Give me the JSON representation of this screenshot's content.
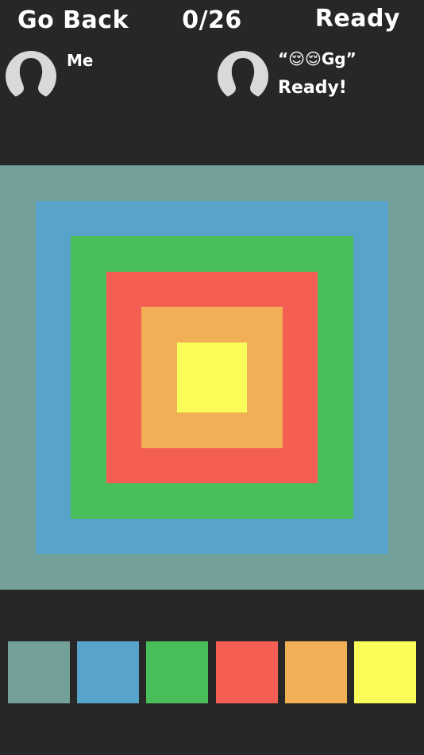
{
  "header": {
    "back_label": "Go Back",
    "score_label": "0/26",
    "ready_label": "Ready"
  },
  "players": {
    "me": {
      "name": "Me",
      "status": ""
    },
    "opponent": {
      "name": "“😌😌Gg”",
      "status": "Ready!"
    }
  },
  "icons": {
    "avatar": "person-silhouette-icon"
  },
  "board": {
    "rings": [
      {
        "color_name": "teal",
        "color": "#73a19a"
      },
      {
        "color_name": "blue",
        "color": "#58a3c9"
      },
      {
        "color_name": "green",
        "color": "#4bbe5c"
      },
      {
        "color_name": "red",
        "color": "#f45e53"
      },
      {
        "color_name": "orange",
        "color": "#f2b056"
      },
      {
        "color_name": "yellow",
        "color": "#fbfd58"
      }
    ]
  },
  "palette": {
    "swatches": [
      {
        "color_name": "teal",
        "color": "#73a19a"
      },
      {
        "color_name": "blue",
        "color": "#58a3c9"
      },
      {
        "color_name": "green",
        "color": "#4bbe5c"
      },
      {
        "color_name": "red",
        "color": "#f45e53"
      },
      {
        "color_name": "orange",
        "color": "#f2b056"
      },
      {
        "color_name": "yellow",
        "color": "#fbfd58"
      }
    ]
  }
}
